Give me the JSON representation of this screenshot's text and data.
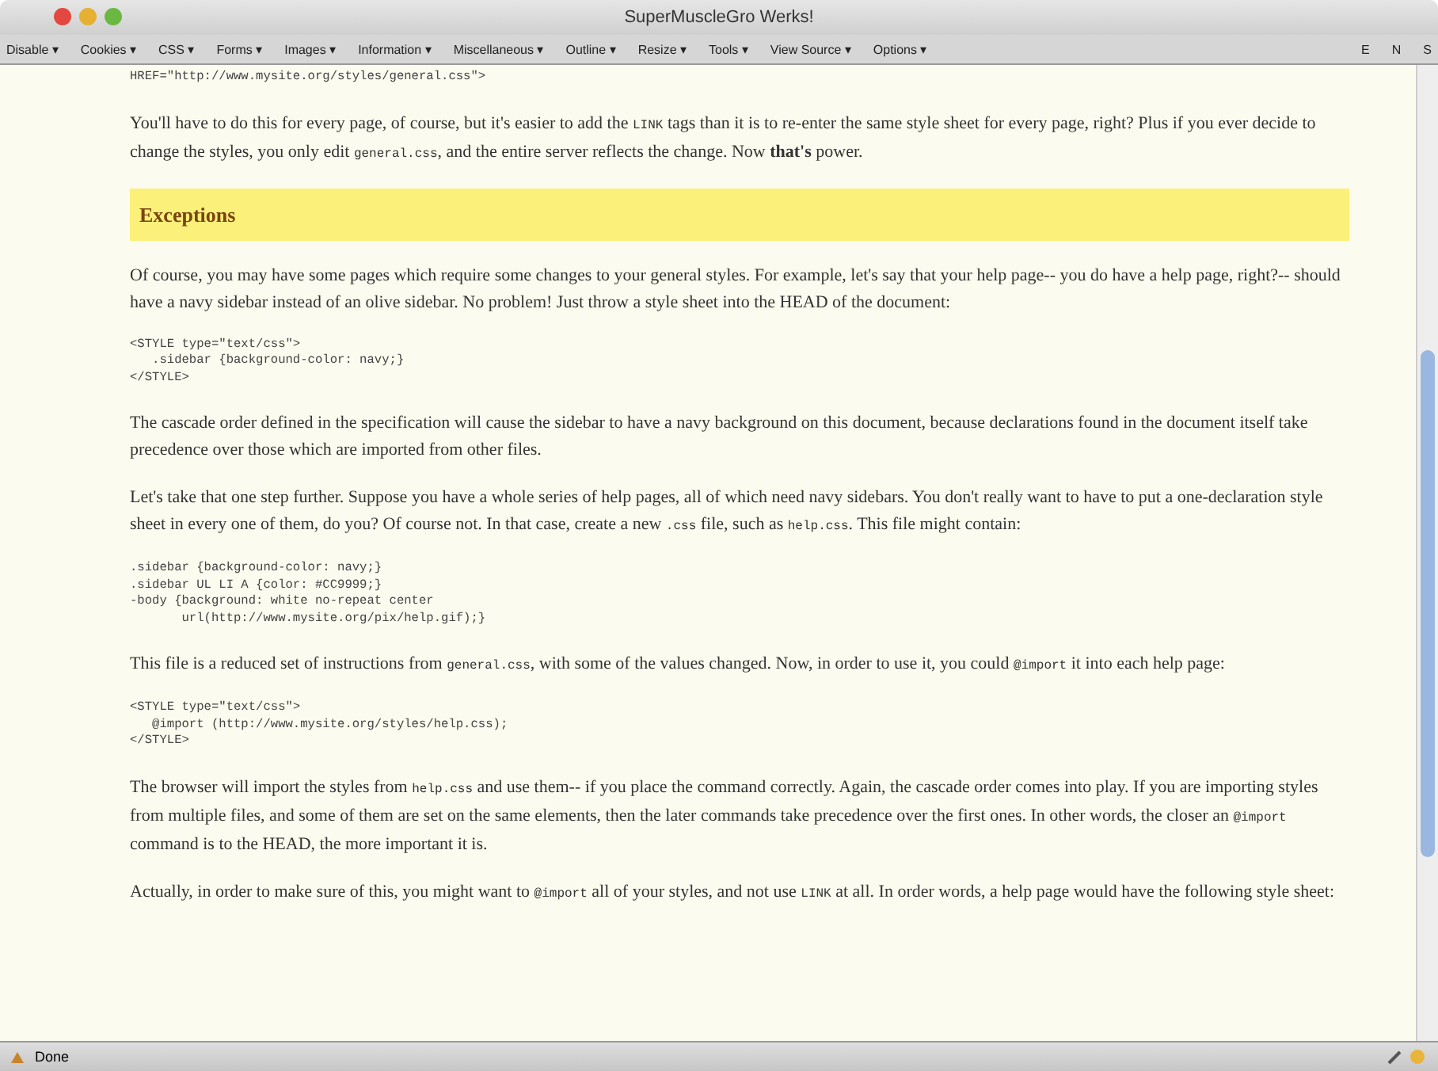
{
  "window": {
    "title": "SuperMuscleGro Werks!"
  },
  "toolbar": {
    "menus": [
      {
        "label": "Disable ▾"
      },
      {
        "label": "Cookies ▾"
      },
      {
        "label": "CSS ▾"
      },
      {
        "label": "Forms ▾"
      },
      {
        "label": "Images ▾"
      },
      {
        "label": "Information ▾"
      },
      {
        "label": "Miscellaneous ▾"
      },
      {
        "label": "Outline ▾"
      },
      {
        "label": "Resize ▾"
      },
      {
        "label": "Tools ▾"
      },
      {
        "label": "View Source ▾"
      },
      {
        "label": "Options ▾"
      }
    ],
    "indicators": [
      "E",
      "N",
      "S"
    ]
  },
  "content": [
    {
      "kind": "code",
      "lines": [
        "HREF=\"http://www.mysite.org/styles/general.css\">"
      ]
    },
    {
      "kind": "para",
      "parts": [
        {
          "kind": "text",
          "text": "You'll have to do this for every page, of course, but it's easier to add the "
        },
        {
          "kind": "code",
          "text": "LINK"
        },
        {
          "kind": "text",
          "text": " tags than it is to re-enter the same style sheet for every page, right? Plus if you ever decide to change the styles, you only edit "
        },
        {
          "kind": "code",
          "text": "general.css"
        },
        {
          "kind": "text",
          "text": ", and the entire server reflects the change. Now **that's** power."
        }
      ]
    },
    {
      "kind": "heading",
      "text": "Exceptions"
    },
    {
      "kind": "para",
      "parts": [
        {
          "kind": "text",
          "text": "Of course, you may have some pages which require some changes to your general styles. For example, let's say that your help page-- you do have a help page, right?-- should have a navy sidebar instead of an olive sidebar. No problem! Just throw a style sheet into the HEAD of the document:"
        }
      ]
    },
    {
      "kind": "code",
      "lines": [
        "<STYLE type=\"text/css\">",
        "   .sidebar {background-color: navy;}",
        "</STYLE>"
      ]
    },
    {
      "kind": "para",
      "parts": [
        {
          "kind": "text",
          "text": "The cascade order defined in the specification will cause the sidebar to have a navy background on this document, because declarations found in the document itself take precedence over those which are imported from other files."
        }
      ]
    },
    {
      "kind": "para",
      "parts": [
        {
          "kind": "text",
          "text": "Let's take that one step further. Suppose you have a whole series of help pages, all of which need navy sidebars. You don't really want to have to put a one-declaration style sheet in every one of them, do you? Of course not. In that case, create a new "
        },
        {
          "kind": "code",
          "text": ".css"
        },
        {
          "kind": "text",
          "text": " file, such as "
        },
        {
          "kind": "code",
          "text": "help.css"
        },
        {
          "kind": "text",
          "text": ". This file might contain:"
        }
      ]
    },
    {
      "kind": "code",
      "lines": [
        ".sidebar {background-color: navy;}",
        ".sidebar UL LI A {color: #CC9999;}",
        "-body {background: white no-repeat center",
        "       url(http://www.mysite.org/pix/help.gif);}"
      ]
    },
    {
      "kind": "para",
      "parts": [
        {
          "kind": "text",
          "text": "This file is a reduced set of instructions from "
        },
        {
          "kind": "code",
          "text": "general.css"
        },
        {
          "kind": "text",
          "text": ", with some of the values changed. Now, in order to use it, you could "
        },
        {
          "kind": "code",
          "text": "@import"
        },
        {
          "kind": "text",
          "text": " it into each help page:"
        }
      ]
    },
    {
      "kind": "code",
      "lines": [
        "<STYLE type=\"text/css\">",
        "   @import (http://www.mysite.org/styles/help.css);",
        "</STYLE>"
      ]
    },
    {
      "kind": "para",
      "parts": [
        {
          "kind": "text",
          "text": "The browser will import the styles from "
        },
        {
          "kind": "code",
          "text": "help.css"
        },
        {
          "kind": "text",
          "text": " and use them-- if you place the command correctly. Again, the cascade order comes into play. If you are importing styles from multiple files, and some of them are set on the same elements, then the later commands take precedence over the first ones. In other words, the closer an "
        },
        {
          "kind": "code",
          "text": "@import"
        },
        {
          "kind": "text",
          "text": " command is to the HEAD, the more important it is."
        }
      ]
    },
    {
      "kind": "para",
      "parts": [
        {
          "kind": "text",
          "text": "Actually, in order to make sure of this, you might want to "
        },
        {
          "kind": "code",
          "text": "@import"
        },
        {
          "kind": "text",
          "text": " all of your styles, and not use "
        },
        {
          "kind": "code",
          "text": "LINK"
        },
        {
          "kind": "text",
          "text": " at all. In order words, a help page would have the following style sheet:"
        }
      ]
    }
  ],
  "status_bar": {
    "text": "Done"
  }
}
